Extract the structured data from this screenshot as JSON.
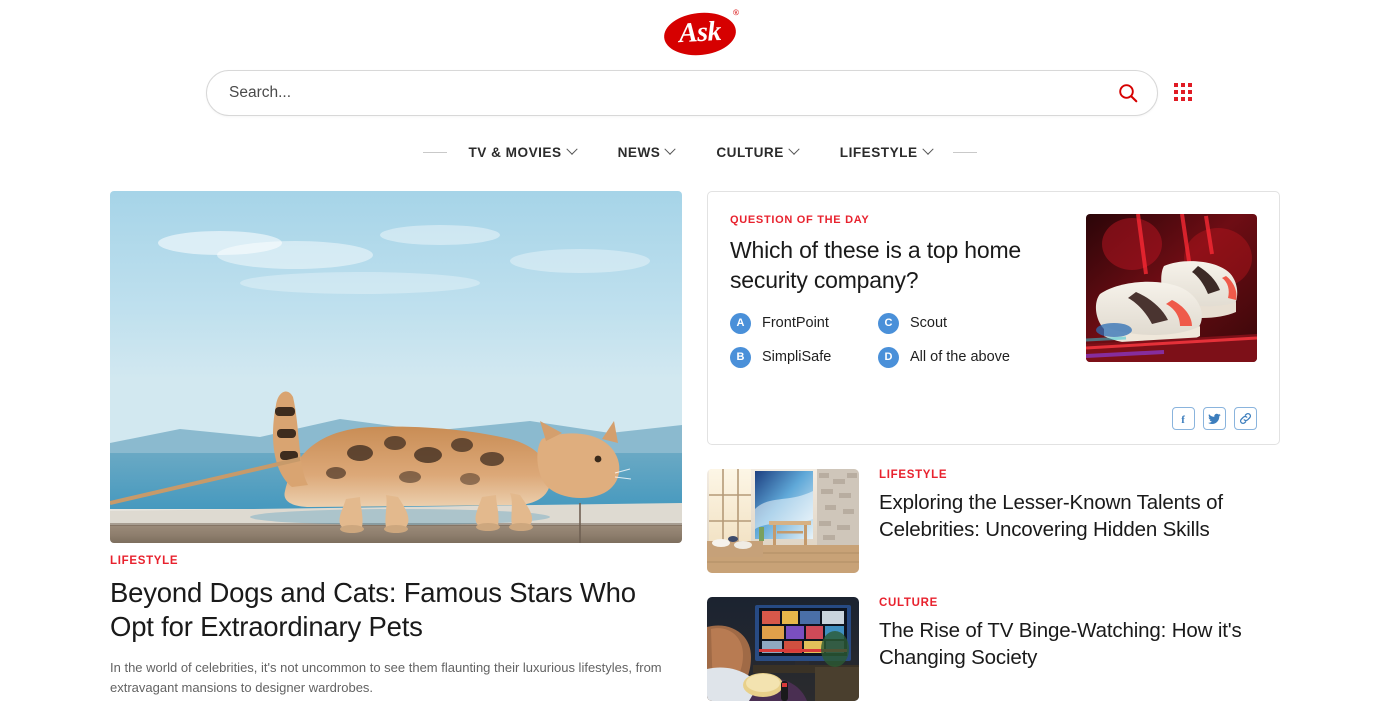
{
  "brand": {
    "logo_text": "Ask",
    "trademark": "®"
  },
  "search": {
    "placeholder": "Search...",
    "value": "",
    "search_icon": "search-icon",
    "apps_icon": "apps-grid-icon",
    "accent_color": "#d60000"
  },
  "nav": {
    "items": [
      {
        "label": "TV & MOVIES",
        "has_chevron": true
      },
      {
        "label": "NEWS",
        "has_chevron": true
      },
      {
        "label": "CULTURE",
        "has_chevron": true
      },
      {
        "label": "LIFESTYLE",
        "has_chevron": true
      }
    ]
  },
  "hero": {
    "kicker": "LIFESTYLE",
    "title": "Beyond Dogs and Cats: Famous Stars Who Opt for Extraordinary Pets",
    "dek": "In the world of celebrities, it's not uncommon to see them flaunting their luxurious lifestyles, from extravagant mansions to designer wardrobes.",
    "image_alt": "bengal-cat-walking-on-wooden-deck-by-the-sea"
  },
  "qotd": {
    "kicker": "QUESTION OF THE DAY",
    "question": "Which of these is a top home security company?",
    "options": [
      {
        "letter": "A",
        "label": "FrontPoint"
      },
      {
        "letter": "B",
        "label": "SimpliSafe"
      },
      {
        "letter": "C",
        "label": "Scout"
      },
      {
        "letter": "D",
        "label": "All of the above"
      }
    ],
    "image_alt": "white-and-red-sneakers-under-neon-light",
    "share": [
      {
        "name": "facebook-share-button",
        "glyph": "f"
      },
      {
        "name": "twitter-share-button",
        "glyph": "twitter"
      },
      {
        "name": "copy-link-button",
        "glyph": "link"
      }
    ],
    "badge_color": "#4a90d9",
    "kicker_color": "#e8222e"
  },
  "side_articles": [
    {
      "kicker": "LIFESTYLE",
      "title": "Exploring the Lesser-Known Talents of Celebrities: Uncovering Hidden Skills",
      "image_alt": "sunlit-modern-interior-with-wooden-table-and-blue-artwork"
    },
    {
      "kicker": "CULTURE",
      "title": "The Rise of TV Binge-Watching: How it's Changing Society",
      "image_alt": "woman-watching-television-with-popcorn-in-dark-room"
    }
  ]
}
